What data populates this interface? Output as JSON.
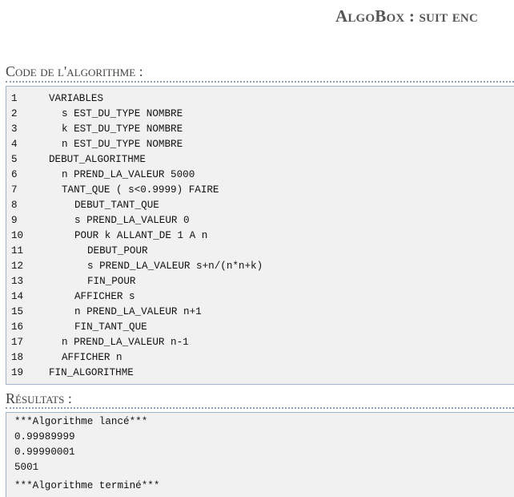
{
  "header": {
    "title": "AlgoBox : suit enc"
  },
  "code_section": {
    "heading": "Code de l'algorithme :",
    "lines": [
      {
        "num": "1",
        "indent": 0,
        "text": "VARIABLES"
      },
      {
        "num": "2",
        "indent": 1,
        "text": "s EST_DU_TYPE NOMBRE"
      },
      {
        "num": "3",
        "indent": 1,
        "text": "k EST_DU_TYPE NOMBRE"
      },
      {
        "num": "4",
        "indent": 1,
        "text": "n EST_DU_TYPE NOMBRE"
      },
      {
        "num": "5",
        "indent": 0,
        "text": "DEBUT_ALGORITHME"
      },
      {
        "num": "6",
        "indent": 1,
        "text": "n PREND_LA_VALEUR 5000"
      },
      {
        "num": "7",
        "indent": 1,
        "text": "TANT_QUE ( s<0.9999) FAIRE"
      },
      {
        "num": "8",
        "indent": 2,
        "text": "DEBUT_TANT_QUE"
      },
      {
        "num": "9",
        "indent": 2,
        "text": "s PREND_LA_VALEUR 0"
      },
      {
        "num": "10",
        "indent": 2,
        "text": "POUR k ALLANT_DE 1 A n"
      },
      {
        "num": "11",
        "indent": 3,
        "text": "DEBUT_POUR"
      },
      {
        "num": "12",
        "indent": 3,
        "text": "s PREND_LA_VALEUR s+n/(n*n+k)"
      },
      {
        "num": "13",
        "indent": 3,
        "text": "FIN_POUR"
      },
      {
        "num": "14",
        "indent": 2,
        "text": "AFFICHER s"
      },
      {
        "num": "15",
        "indent": 2,
        "text": "n PREND_LA_VALEUR n+1"
      },
      {
        "num": "16",
        "indent": 2,
        "text": "FIN_TANT_QUE"
      },
      {
        "num": "17",
        "indent": 1,
        "text": "n PREND_LA_VALEUR n-1"
      },
      {
        "num": "18",
        "indent": 1,
        "text": "AFFICHER n"
      },
      {
        "num": "19",
        "indent": 0,
        "text": "FIN_ALGORITHME"
      }
    ]
  },
  "results_section": {
    "heading": "Résultats :",
    "lines": [
      "***Algorithme lancé***",
      "0.99989999",
      "0.99990001",
      "5001",
      "***Algorithme terminé***"
    ]
  }
}
